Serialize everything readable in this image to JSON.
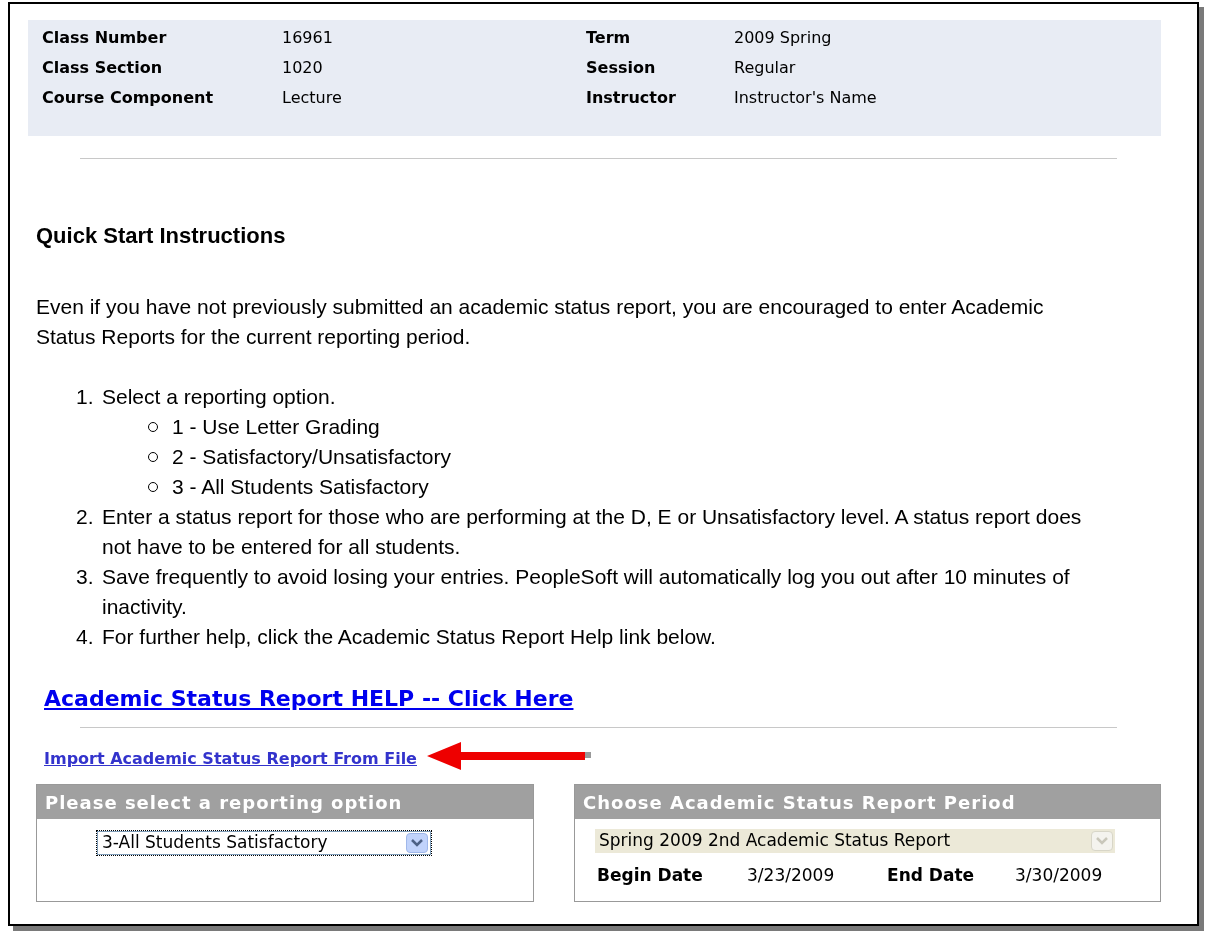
{
  "class_info": {
    "left": [
      {
        "label": "Class Number",
        "value": "16961"
      },
      {
        "label": "Class Section",
        "value": "1020"
      },
      {
        "label": "Course Component",
        "value": "Lecture"
      }
    ],
    "right": [
      {
        "label": "Term",
        "value": "2009 Spring"
      },
      {
        "label": "Session",
        "value": "Regular"
      },
      {
        "label": "Instructor",
        "value": "Instructor's Name"
      }
    ]
  },
  "instructions": {
    "heading": "Quick Start Instructions",
    "intro": "Even if you have not previously submitted an academic status report, you are encouraged to enter Academic Status Reports for the current reporting period.",
    "steps": [
      {
        "number": "1.",
        "text": "Select a reporting option.",
        "children": [
          {
            "text": "1 - Use Letter Grading"
          },
          {
            "text": "2 - Satisfactory/Unsatisfactory"
          },
          {
            "text": "3 - All Students Satisfactory"
          }
        ]
      },
      {
        "number": "2.",
        "text": "Enter a status report for those who are performing at the D, E or Unsatisfactory level. A status report does not have to be entered for all students."
      },
      {
        "number": "3.",
        "text": "Save frequently to avoid losing your entries. PeopleSoft will automatically log you out after 10 minutes of inactivity."
      },
      {
        "number": "4.",
        "text": "For further help, click the Academic Status Report Help link below."
      }
    ]
  },
  "help_link": "Academic Status Report HELP -- Click Here",
  "import_link": "Import Academic Status Report From File",
  "reporting_panel": {
    "title": "Please select a reporting option",
    "select": {
      "value": "3-All Students Satisfactory",
      "disabled": false
    }
  },
  "period_panel": {
    "title": "Choose Academic Status Report Period",
    "select": {
      "value": "Spring 2009 2nd Academic Status Report",
      "disabled": true
    },
    "begin_label": "Begin Date",
    "begin_value": "3/23/2009",
    "end_label": "End Date",
    "end_value": "3/30/2009"
  }
}
